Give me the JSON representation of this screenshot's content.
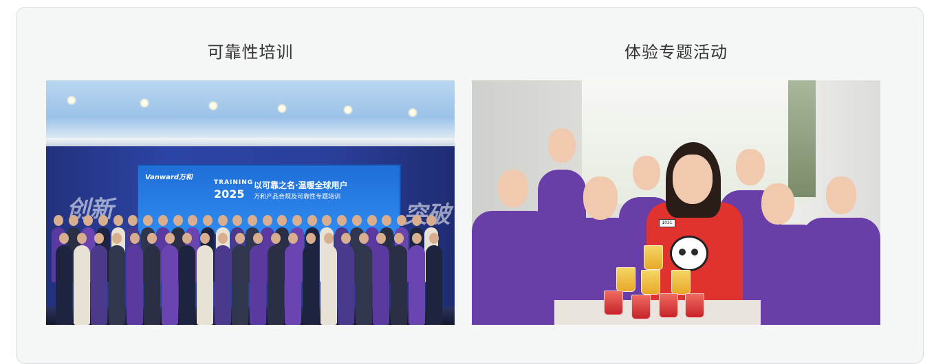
{
  "panels": [
    {
      "title": "可靠性培训",
      "photo_text": {
        "brand": "Vanward万和",
        "event": "TRAINING",
        "year": "2025",
        "slogan": "以可靠之名·温暖全球用户",
        "sub": "万和产品合规及可靠性专题培训",
        "wall_left": "创新",
        "wall_right": "突破"
      }
    },
    {
      "title": "体验专题活动",
      "photo_text": {
        "badge": "1031"
      }
    }
  ],
  "colors": {
    "card_bg": "#f5f6f6",
    "card_border": "#d9dcdc",
    "title_text": "#333333",
    "team_shirt": "#6a3ea8",
    "hall_wall": "#2c44a6"
  }
}
